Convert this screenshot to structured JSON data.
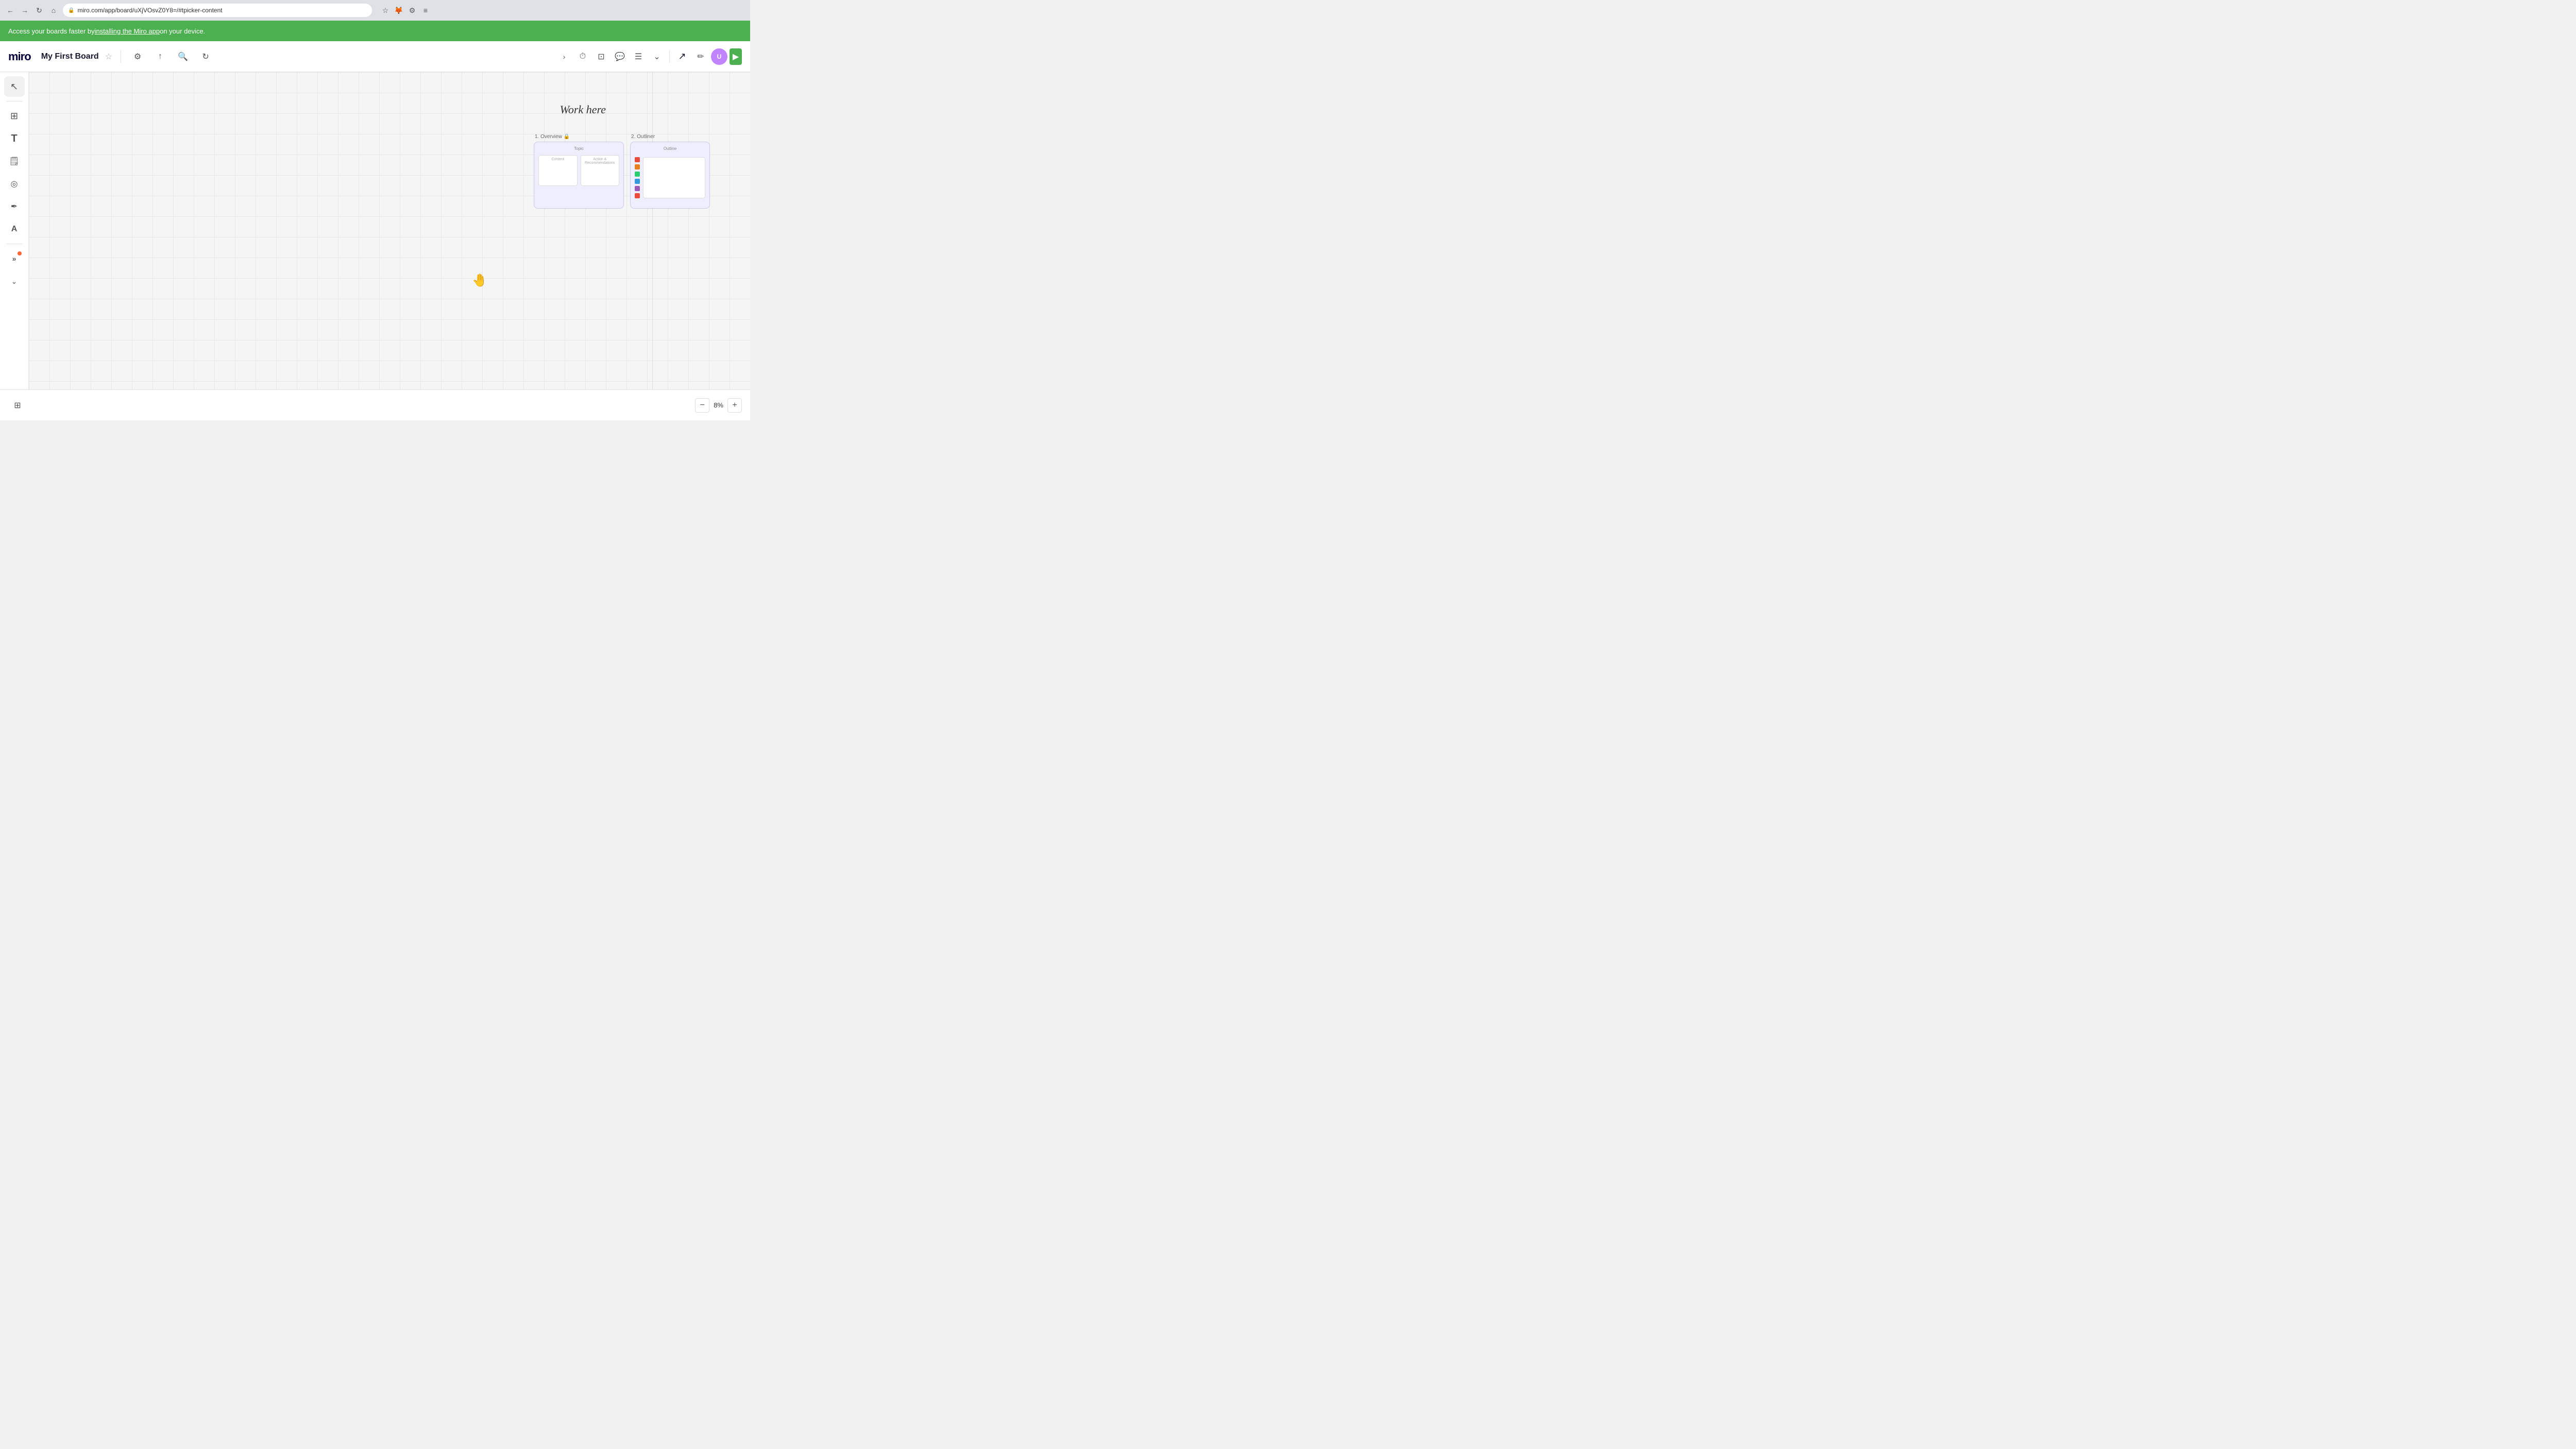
{
  "browser": {
    "url": "miro.com/app/board/uXjVOsvZ0Y8=/#tpicker-content",
    "nav": {
      "back": "←",
      "forward": "→",
      "refresh": "↻",
      "home": "⌂"
    }
  },
  "banner": {
    "text": "Access your boards faster by ",
    "link_text": "installing the Miro app",
    "text_after": " on your device."
  },
  "header": {
    "logo": "miro",
    "board_title": "My First Board",
    "star_icon": "☆",
    "settings_icon": "⚙",
    "share_icon": "↑",
    "search_icon": "🔍",
    "sync_icon": "↻",
    "toolbar_icons": [
      {
        "name": "timer",
        "icon": "⏱"
      },
      {
        "name": "frame",
        "icon": "⊡"
      },
      {
        "name": "comment",
        "icon": "💬"
      },
      {
        "name": "list",
        "icon": "☰"
      },
      {
        "name": "more",
        "icon": "⌄"
      }
    ]
  },
  "right_toolbar": {
    "arrow_icon": "↗",
    "pen_icon": "✏",
    "avatar_initials": "U"
  },
  "left_sidebar": {
    "tools": [
      {
        "name": "select",
        "icon": "↖",
        "active": true
      },
      {
        "name": "frames",
        "icon": "⊞"
      },
      {
        "name": "text",
        "icon": "T"
      },
      {
        "name": "sticky",
        "icon": "🗒"
      },
      {
        "name": "shapes",
        "icon": "◎"
      },
      {
        "name": "pen",
        "icon": "✏"
      },
      {
        "name": "marker",
        "icon": "A"
      },
      {
        "name": "more-tools",
        "icon": "»",
        "has_dot": true
      },
      {
        "name": "expand",
        "icon": "⌄"
      }
    ]
  },
  "canvas": {
    "work_here_text": "Work here",
    "cursor": "👋"
  },
  "frames": {
    "frame1": {
      "label": "1. Overview 🔒",
      "inner_title": "Topic",
      "sub_labels": [
        "Content",
        "Action & Recommendations"
      ]
    },
    "frame2": {
      "label": "2. Outliner",
      "inner_title": "Outline",
      "colors": [
        "#e74c3c",
        "#e67e22",
        "#2ecc71",
        "#3498db",
        "#9b59b6",
        "#e74c3c"
      ]
    }
  },
  "bottom_bar": {
    "frames_icon": "⊞",
    "zoom_out": "−",
    "zoom_level": "8%",
    "zoom_in": "+"
  }
}
